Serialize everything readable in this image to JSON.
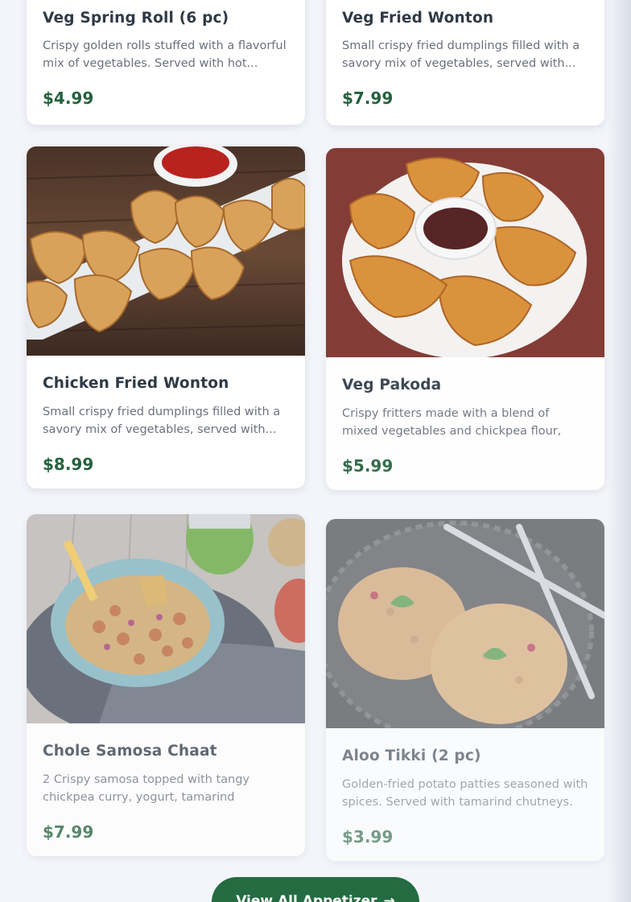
{
  "menu": {
    "items": [
      {
        "name": "Veg Spring Roll (6 pc)",
        "description": "Crispy golden rolls stuffed with a flavorful mix of vegetables. Served with hot...",
        "price": "$4.99"
      },
      {
        "name": "Veg Fried Wonton",
        "description": "Small crispy fried dumplings filled with a savory mix of vegetables, served with...",
        "price": "$7.99"
      },
      {
        "name": "Chicken Fried Wonton",
        "description": "Small crispy fried dumplings filled with a savory mix of vegetables, served with...",
        "price": "$8.99"
      },
      {
        "name": "Veg Pakoda",
        "description": "Crispy fritters made with a blend of mixed vegetables and chickpea flour, deep-f...",
        "price": "$5.99"
      },
      {
        "name": "Chole Samosa Chaat",
        "description": "2 Crispy samosa topped with tangy chickpea curry, yogurt, tamarind chutney...",
        "price": "$7.99"
      },
      {
        "name": "Aloo Tikki (2 pc)",
        "description": "Golden-fried potato patties seasoned with spices. Served with tamarind chutneys.",
        "price": "$3.99"
      }
    ]
  },
  "cta": {
    "label": "View All Appetizer",
    "icon": "arrow-right-icon"
  },
  "colors": {
    "price": "#25613d",
    "button": "#246b41",
    "title": "#2f3a46"
  }
}
